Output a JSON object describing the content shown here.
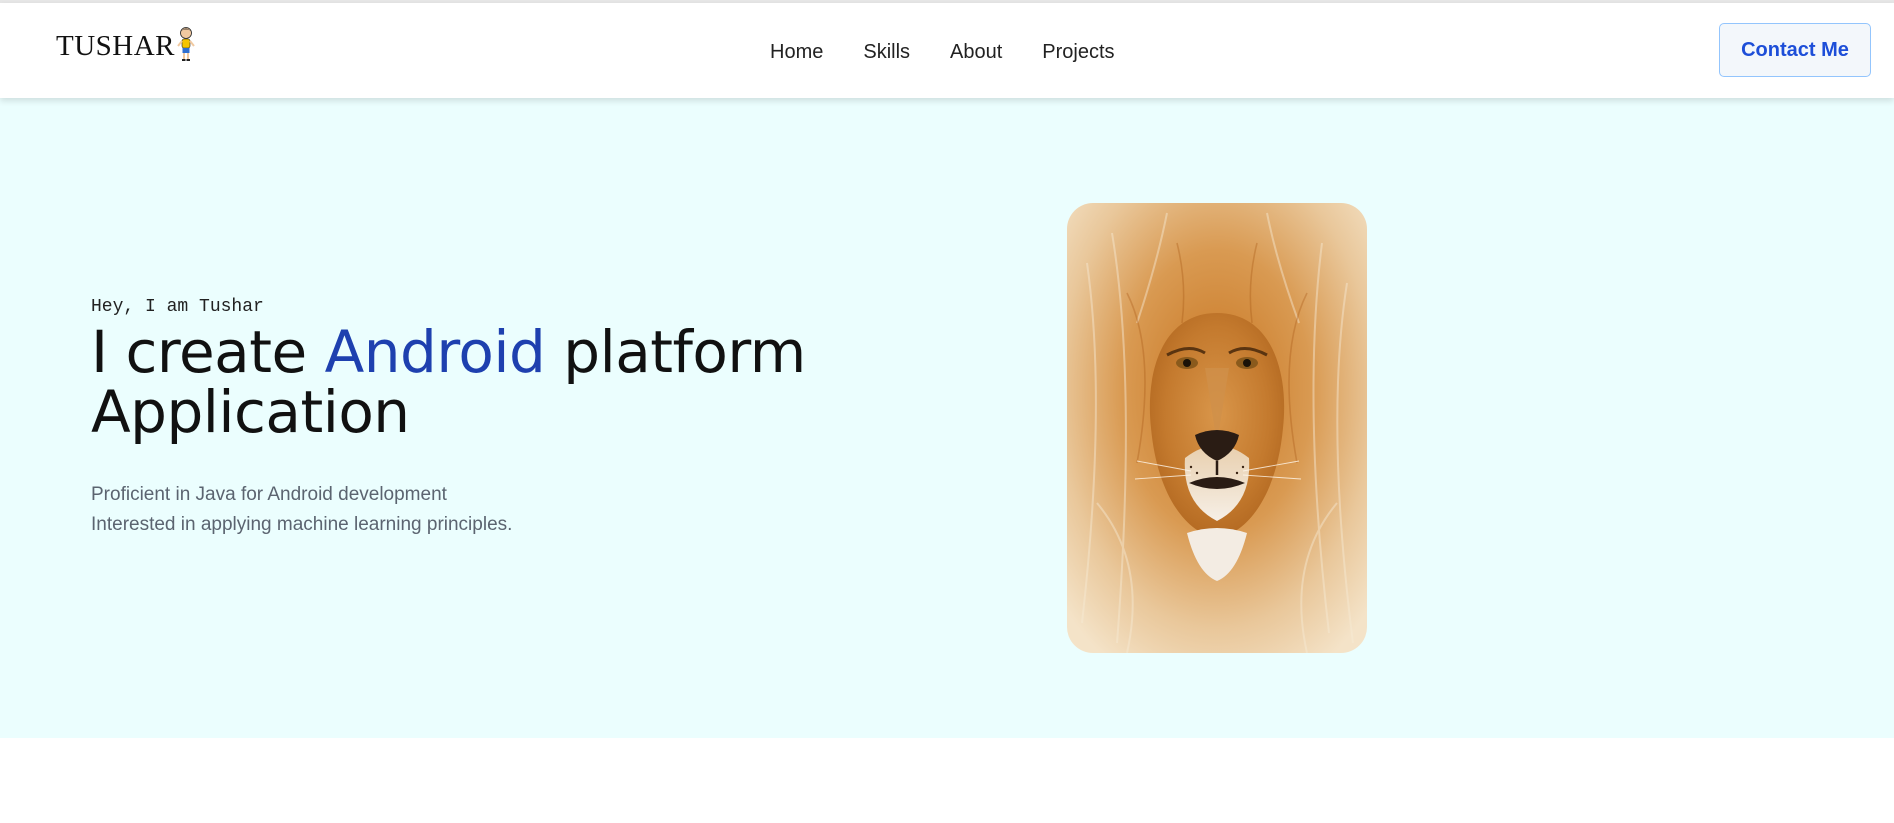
{
  "logo": {
    "text": "TUSHAR"
  },
  "nav": {
    "items": [
      {
        "label": "Home"
      },
      {
        "label": "Skills"
      },
      {
        "label": "About"
      },
      {
        "label": "Projects"
      }
    ]
  },
  "header": {
    "contact_label": "Contact Me"
  },
  "hero": {
    "greeting": "Hey, I am Tushar",
    "headline_prefix": "I create ",
    "headline_accent": "Android",
    "headline_suffix": " platform Application",
    "desc_line1": "Proficient in Java for Android development",
    "desc_line2": "Interested in applying machine learning principles."
  },
  "colors": {
    "accent": "#1e40af",
    "hero_background": "#ebfefe",
    "button_border": "#93c5fd"
  },
  "icons": {
    "logo_figure": "kid-figure-icon",
    "hero_image": "lion-portrait"
  }
}
